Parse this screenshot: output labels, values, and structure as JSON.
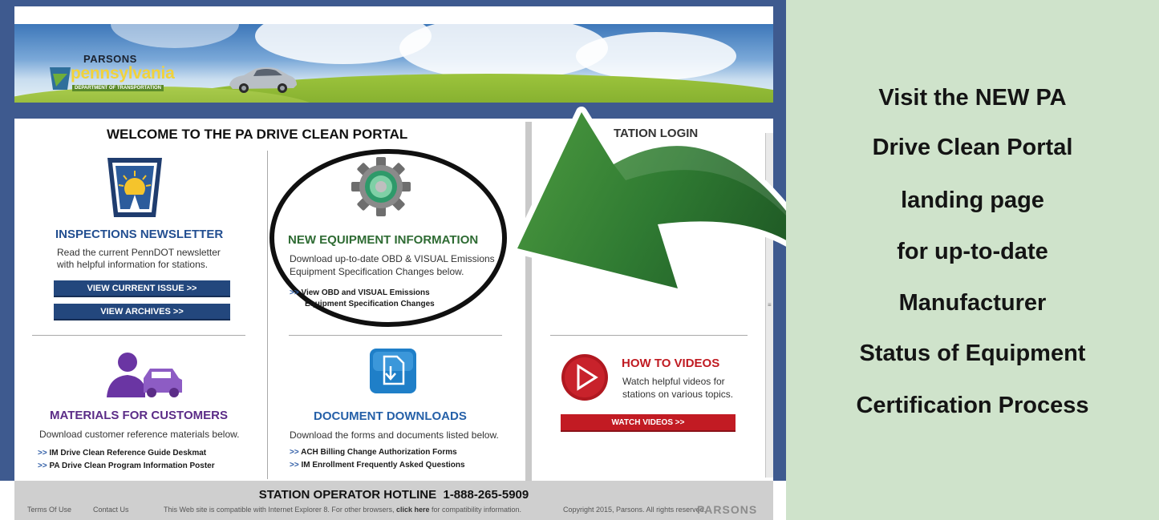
{
  "banner": {
    "brand_company": "PARSONS",
    "brand_state": "pennsylvania",
    "brand_department": "DEPARTMENT OF TRANSPORTATION"
  },
  "main": {
    "welcome_title": "WELCOME TO THE PA DRIVE CLEAN PORTAL",
    "station_login_title": "TATION LOGIN"
  },
  "newsletter": {
    "title": "INSPECTIONS NEWSLETTER",
    "text_line1": "Read the current PennDOT newsletter",
    "text_line2": "with helpful information for stations.",
    "btn_current": "VIEW CURRENT ISSUE >>",
    "btn_archives": "VIEW ARCHIVES >>"
  },
  "equipment": {
    "title": "NEW EQUIPMENT INFORMATION",
    "text_line1": "Download up-to-date OBD & VISUAL Emissions",
    "text_line2": "Equipment Specification Changes below.",
    "link_line1": "View OBD and VISUAL Emissions",
    "link_line2": "Equipment Specification Changes"
  },
  "videos": {
    "title": "HOW TO VIDEOS",
    "text_line1": "Watch helpful videos for",
    "text_line2": "stations on various topics.",
    "btn_watch": "WATCH VIDEOS >>"
  },
  "customers": {
    "title": "MATERIALS FOR CUSTOMERS",
    "text": "Download customer reference materials below.",
    "link1": "IM Drive Clean Reference Guide Deskmat",
    "link2": "PA Drive Clean Program Information Poster"
  },
  "documents": {
    "title": "DOCUMENT DOWNLOADS",
    "text": "Download the forms and documents listed below.",
    "link1": "ACH Billing Change Authorization Forms",
    "link2": "IM Enrollment Frequently Asked Questions"
  },
  "link_marker": ">>",
  "footer": {
    "hotline": "STATION OPERATOR HOTLINE  1-888-265-5909",
    "terms": "Terms Of Use",
    "contact": "Contact Us",
    "compat_pre": "This Web site is compatible with Internet Explorer 8. For other browsers,",
    "compat_link": "click here",
    "compat_post": "for compatibility information.",
    "copyright": "Copyright 2015, Parsons. All rights reserved.",
    "footer_logo": "PARSONS"
  },
  "promo": {
    "lines": [
      "Visit the NEW PA",
      "Drive Clean Portal",
      "landing page",
      "for up-to-date",
      "Manufacturer",
      "Status of Equipment",
      "Certification Process"
    ]
  },
  "colors": {
    "nav_blue": "#3e5a8f",
    "title_blue": "#234f91",
    "title_green": "#2e6b33",
    "title_purple": "#5b2c87",
    "title_red": "#c01b22",
    "arrow_green": "#3f8a3a",
    "promo_bg": "#cfe3cb"
  },
  "icons": {
    "newsletter": "keystone-sun-icon",
    "equipment": "gear-icon",
    "customers": "person-car-icon",
    "documents": "document-download-icon",
    "videos": "play-icon",
    "callout": "curved-arrow-icon"
  }
}
